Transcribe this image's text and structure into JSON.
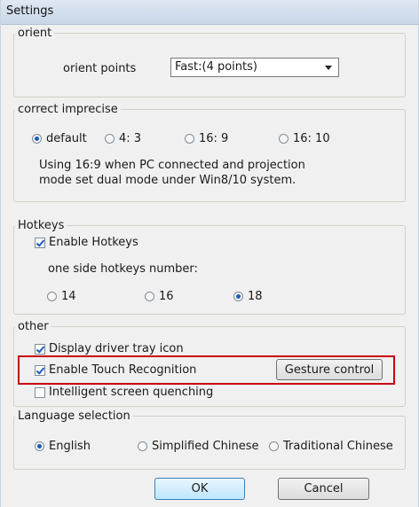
{
  "window": {
    "title": "Settings"
  },
  "orient": {
    "legend": "orient",
    "points_label": "orient points",
    "points_value": "Fast:(4 points)"
  },
  "correct": {
    "legend": "correct imprecise",
    "options": [
      {
        "label": "default",
        "selected": true
      },
      {
        "label": "4: 3",
        "selected": false
      },
      {
        "label": "16: 9",
        "selected": false
      },
      {
        "label": "16: 10",
        "selected": false
      }
    ],
    "note_line1": "Using 16:9 when PC connected and projection",
    "note_line2": "mode set dual mode under Win8/10 system."
  },
  "hotkeys": {
    "legend": "Hotkeys",
    "enable_label": "Enable Hotkeys",
    "enable_checked": true,
    "number_label": "one side hotkeys number:",
    "options": [
      {
        "label": "14",
        "selected": false
      },
      {
        "label": "16",
        "selected": false
      },
      {
        "label": "18",
        "selected": true
      }
    ]
  },
  "other": {
    "legend": "other",
    "tray_label": "Display driver tray icon",
    "tray_checked": true,
    "touch_label": "Enable Touch Recognition",
    "touch_checked": true,
    "gesture_button": "Gesture control",
    "quench_label": "Intelligent screen quenching",
    "quench_checked": false
  },
  "language": {
    "legend": "Language selection",
    "options": [
      {
        "label": "English",
        "selected": true
      },
      {
        "label": "Simplified Chinese",
        "selected": false
      },
      {
        "label": "Traditional Chinese",
        "selected": false
      }
    ]
  },
  "buttons": {
    "ok": "OK",
    "cancel": "Cancel"
  },
  "colors": {
    "highlight_box": "#c8000a",
    "radio_dot": "#1b5bb8"
  }
}
